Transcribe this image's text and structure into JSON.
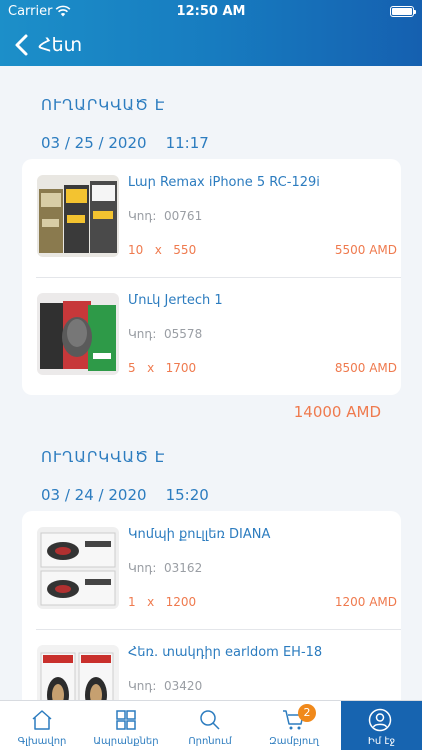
{
  "status_bar": {
    "carrier": "Carrier",
    "time": "12:50 AM"
  },
  "nav": {
    "back_label": "Հետ"
  },
  "orders": [
    {
      "status": "ՈՒՂԱՐԿՎԱԾ Է",
      "date": "03 / 25 / 2020    11:17",
      "items": [
        {
          "name": "Լար Remax iPhone 5 RC-129i",
          "code_label": "Կոդ:",
          "code": "00761",
          "qty": "10",
          "x": "x",
          "unit_price": "550",
          "line_total": "5500 AMD"
        },
        {
          "name": "Մուկ Jertech 1",
          "code_label": "Կոդ:",
          "code": "05578",
          "qty": "5",
          "x": "x",
          "unit_price": "1700",
          "line_total": "8500 AMD"
        }
      ],
      "total": "14000 AMD"
    },
    {
      "status": "ՈՒՂԱՐԿՎԱԾ Է",
      "date": "03 / 24 / 2020    15:20",
      "items": [
        {
          "name": "Կոմպի քուլլեռ DIANA",
          "code_label": "Կոդ:",
          "code": "03162",
          "qty": "1",
          "x": "x",
          "unit_price": "1200",
          "line_total": "1200 AMD"
        },
        {
          "name": "Հեռ. տակդիր earldom EH-18",
          "code_label": "Կոդ:",
          "code": "03420"
        }
      ]
    }
  ],
  "tabbar": {
    "home": "Գլխավոր",
    "products": "Ապրանքներ",
    "search": "Որոնում",
    "cart": "Զամբյուղ",
    "cart_badge": "2",
    "profile": "Իմ էջ"
  },
  "colors": {
    "accent": "#2c7cbf",
    "header": "#1b86c6",
    "price": "#ef7a4e",
    "active_tab": "#1764b0",
    "badge": "#f0891b"
  }
}
